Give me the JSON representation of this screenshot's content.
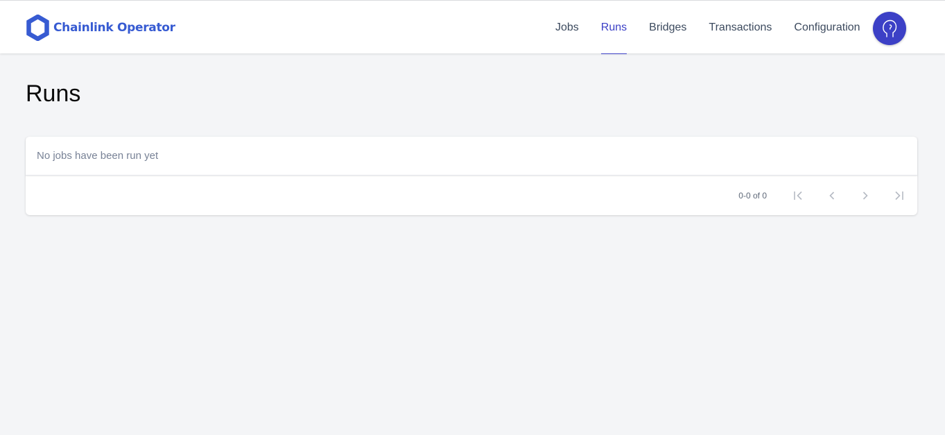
{
  "brand": {
    "name": "Chainlink Operator",
    "logo_icon": "chainlink-hexagon-icon",
    "color": "#375bd2"
  },
  "nav": {
    "items": [
      {
        "label": "Jobs",
        "active": false
      },
      {
        "label": "Runs",
        "active": true
      },
      {
        "label": "Bridges",
        "active": false
      },
      {
        "label": "Transactions",
        "active": false
      },
      {
        "label": "Configuration",
        "active": false
      }
    ],
    "accent_color": "#3c40c6"
  },
  "avatar": {
    "icon": "user-head-icon",
    "color": "#3c40c6"
  },
  "page": {
    "title": "Runs"
  },
  "runs_table": {
    "empty_message": "No jobs have been run yet",
    "pagination": {
      "count_label": "0-0 of 0",
      "first_icon": "first-page-icon",
      "prev_icon": "chevron-left-icon",
      "next_icon": "chevron-right-icon",
      "last_icon": "last-page-icon"
    }
  }
}
